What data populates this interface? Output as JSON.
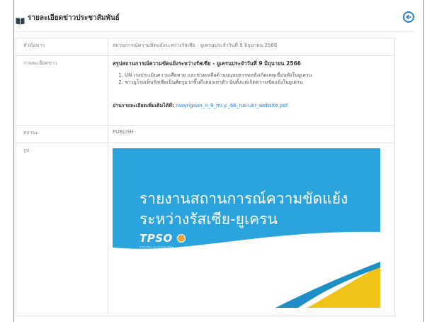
{
  "header": {
    "title": "รายละเอียดข่าวประชาสัมพันธ์",
    "icon": "book-icon",
    "back_icon": "arrow-left-circle-icon",
    "accent_color": "#2e7bcf"
  },
  "fields": {
    "title_label": "หัวข้อข่าว",
    "title_value": "สถานการณ์ความขัดแย้งระหว่างรัสเซีย - ยูเครนประจำวันที่ 9 มิถุนายน 2566",
    "detail_label": "รายละเอียดข่าว",
    "detail_heading": "สรุปสถานการณ์ความขัดแย้งระหว่างรัสเซีย - ยูเครนประจำวันที่ 9 มิถุนายน 2566",
    "detail_items": [
      "UN เร่งประเมินความเสียหาย และช่วยเหลือด้านมนุษยธรรมหลังเกิดเหตุเขื่อนพังในยูเครน",
      "ชาวยูโรปเห็นรัสเซียเป็นศัตรูมากขึ้นถึงสองเท่าตัว นับตั้งแต่เกิดความขัดแย้งในยูเครน"
    ],
    "detail_more_label": "อ่านรายละเอียดเพิ่มเติมได้ที่:",
    "detail_link": "raayngaan_n_9_mi.y._66_rus-ukr_website.pdf",
    "status_label": "สถานะ",
    "status_value": "PUBLISH",
    "image_label": "รูป"
  },
  "image": {
    "line1": "รายงานสถานการณ์ความขัดแย้ง",
    "line2": "ระหว่างรัสเซีย-ยูเครน",
    "logo_text": "TPSO",
    "logo_subtext": "Trade Policy and Strategy Office",
    "bg_color": "#2ba3dc",
    "accent_color": "#f0c419"
  }
}
